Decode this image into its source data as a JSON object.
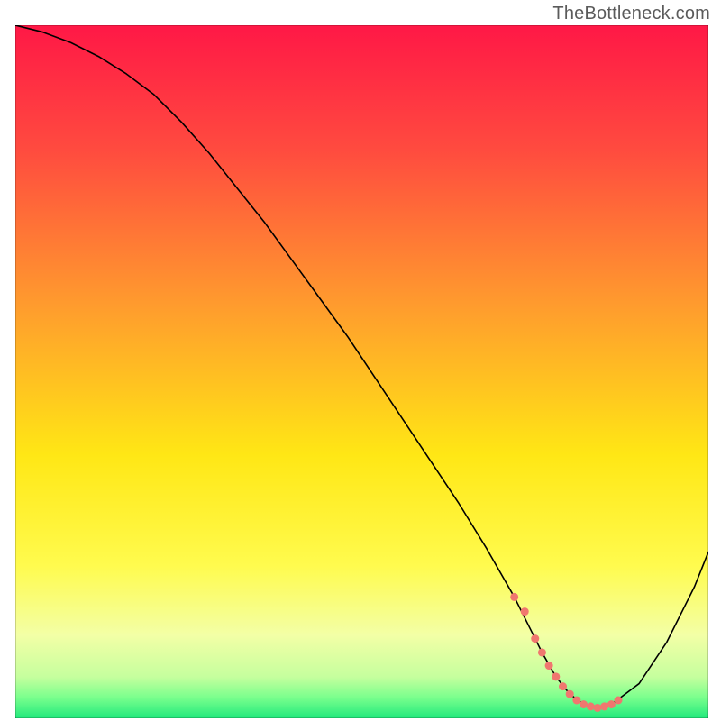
{
  "watermark": "TheBottleneck.com",
  "chart_data": {
    "type": "line",
    "title": "",
    "xlabel": "",
    "ylabel": "",
    "xlim": [
      0,
      100
    ],
    "ylim": [
      0,
      100
    ],
    "grid": false,
    "legend": false,
    "background_gradient_stops": [
      {
        "offset": 0.0,
        "color": "#ff1846"
      },
      {
        "offset": 0.18,
        "color": "#ff4b3f"
      },
      {
        "offset": 0.4,
        "color": "#ff9a2e"
      },
      {
        "offset": 0.62,
        "color": "#ffe715"
      },
      {
        "offset": 0.78,
        "color": "#fffb4e"
      },
      {
        "offset": 0.88,
        "color": "#f3ffa6"
      },
      {
        "offset": 0.94,
        "color": "#c6ff9e"
      },
      {
        "offset": 0.97,
        "color": "#7aff8d"
      },
      {
        "offset": 1.0,
        "color": "#21e97c"
      }
    ],
    "series": [
      {
        "name": "bottleneck-curve",
        "stroke": "#000000",
        "stroke_width": 2,
        "x": [
          0,
          4,
          8,
          12,
          16,
          20,
          24,
          28,
          32,
          36,
          40,
          44,
          48,
          52,
          56,
          60,
          64,
          68,
          72,
          74,
          76,
          78,
          80,
          82,
          84,
          86,
          90,
          94,
          98,
          100
        ],
        "y": [
          100,
          99,
          97.5,
          95.5,
          93,
          90,
          86,
          81.5,
          76.5,
          71.5,
          66,
          60.5,
          55,
          49,
          43,
          37,
          31,
          24.5,
          17.5,
          13.5,
          9.5,
          6,
          3.5,
          2,
          1.5,
          2,
          5,
          11,
          19,
          24
        ]
      }
    ],
    "highlight_markers": {
      "name": "optimal-range",
      "color": "#f0776f",
      "radius": 4.5,
      "x": [
        72,
        73.5,
        75,
        76,
        77,
        78,
        79,
        80,
        81,
        82,
        83,
        84,
        85,
        86,
        87
      ],
      "y": [
        17.5,
        15.4,
        11.5,
        9.5,
        7.6,
        6,
        4.6,
        3.5,
        2.6,
        2,
        1.7,
        1.5,
        1.7,
        2,
        2.6
      ]
    }
  }
}
